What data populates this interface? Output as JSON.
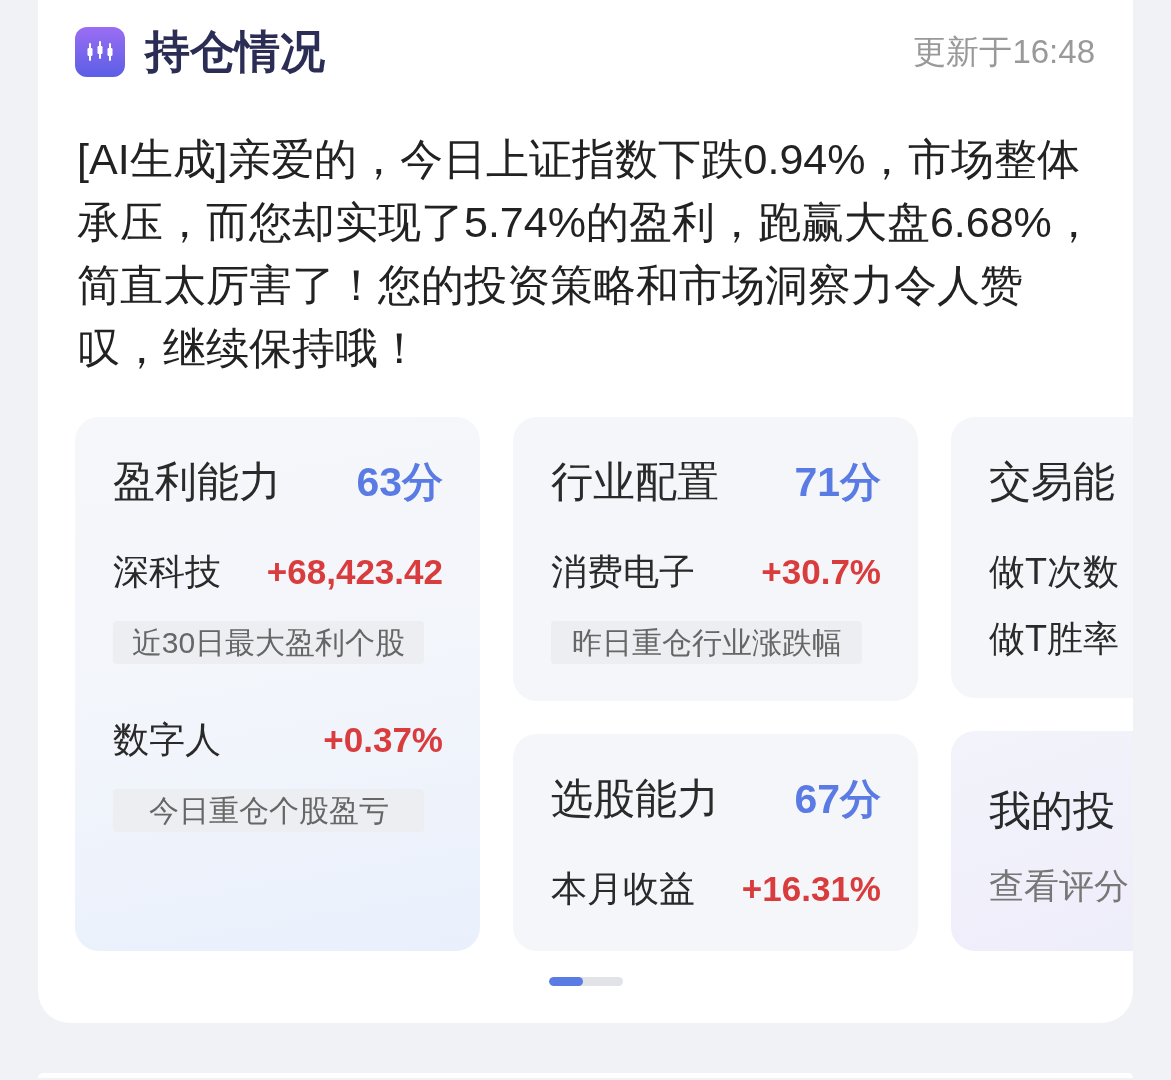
{
  "header": {
    "title": "持仓情况",
    "updated": "更新于16:48"
  },
  "summary": "[AI生成]亲爱的，今日上证指数下跌0.94%，市场整体承压，而您却实现了5.74%的盈利，跑赢大盘6.68%，简直太厉害了！您的投资策略和市场洞察力令人赞叹，继续保持哦！",
  "columns": [
    [
      {
        "kind": "score",
        "title": "盈利能力",
        "score": "63分",
        "entries": [
          {
            "name": "深科技",
            "value": "+68,423.42",
            "note": "近30日最大盈利个股"
          },
          {
            "name": "数字人",
            "value": "+0.37%",
            "note": "今日重仓个股盈亏"
          }
        ]
      }
    ],
    [
      {
        "kind": "score",
        "title": "行业配置",
        "score": "71分",
        "entries": [
          {
            "name": "消费电子",
            "value": "+30.7%",
            "note": "昨日重仓行业涨跌幅"
          }
        ]
      },
      {
        "kind": "score",
        "title": "选股能力",
        "score": "67分",
        "entries": [
          {
            "name": "本月收益",
            "value": "+16.31%"
          }
        ]
      }
    ],
    [
      {
        "kind": "metrics",
        "title": "交易能",
        "labels": [
          "做T次数",
          "做T胜率"
        ]
      },
      {
        "kind": "link",
        "title": "我的投",
        "link": "查看评分"
      }
    ]
  ]
}
